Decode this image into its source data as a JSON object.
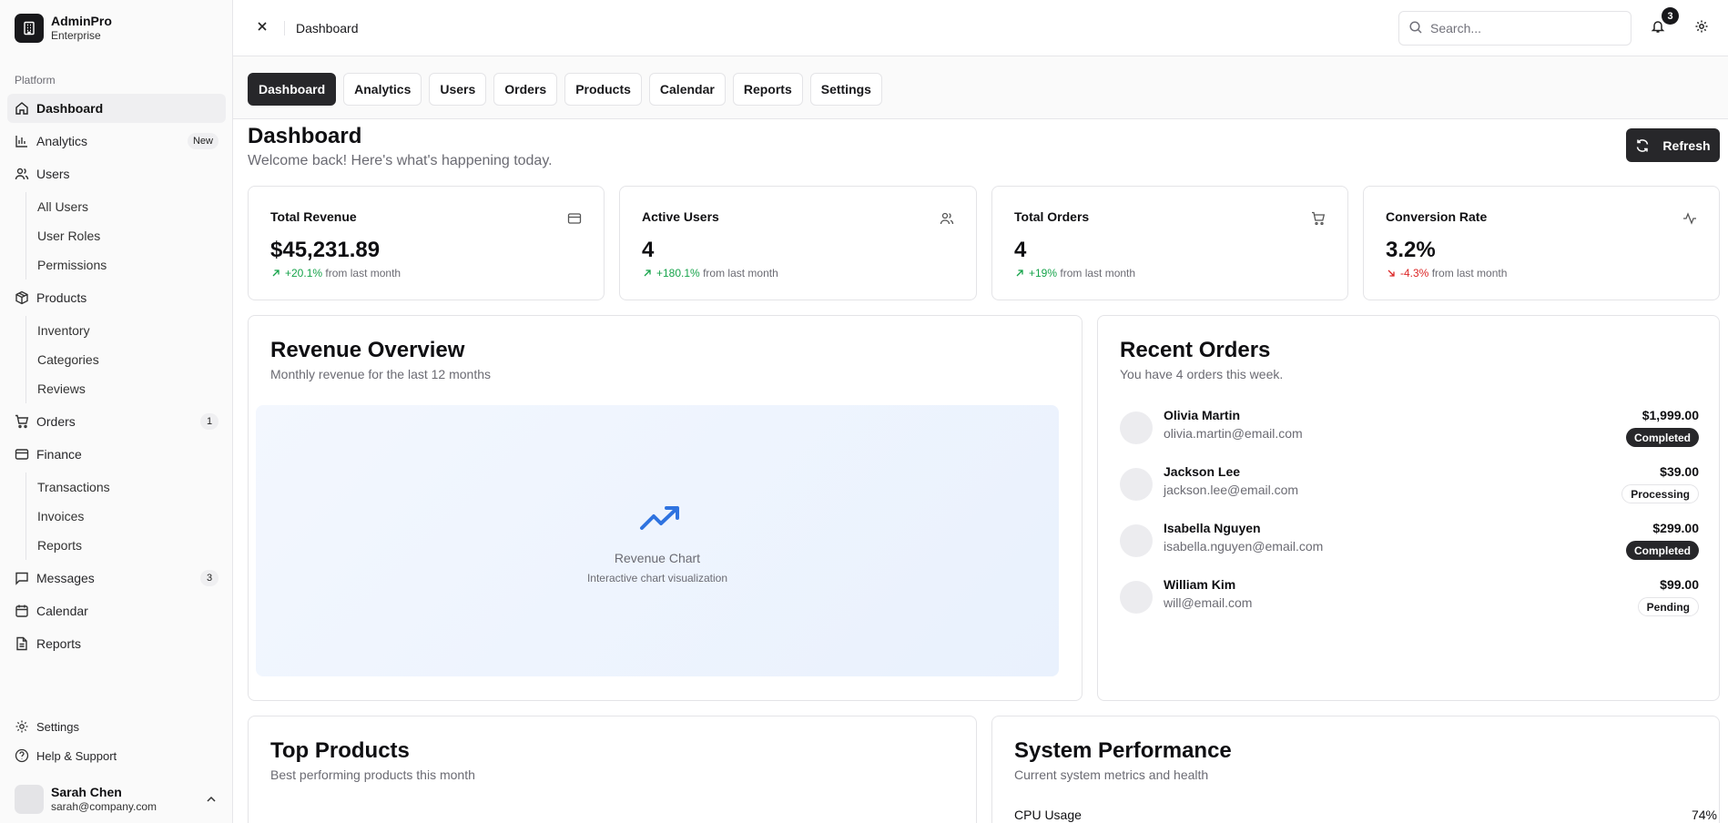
{
  "brand": {
    "name": "AdminPro",
    "subtitle": "Enterprise"
  },
  "sidebar": {
    "group_label": "Platform",
    "items": [
      {
        "label": "Dashboard",
        "icon": "home-icon",
        "active": true
      },
      {
        "label": "Analytics",
        "icon": "bar-chart-icon",
        "badge": "New"
      },
      {
        "label": "Users",
        "icon": "users-icon",
        "children": [
          "All Users",
          "User Roles",
          "Permissions"
        ]
      },
      {
        "label": "Products",
        "icon": "package-icon",
        "children": [
          "Inventory",
          "Categories",
          "Reviews"
        ]
      },
      {
        "label": "Orders",
        "icon": "cart-icon",
        "badge": "1"
      },
      {
        "label": "Finance",
        "icon": "credit-card-icon",
        "children": [
          "Transactions",
          "Invoices",
          "Reports"
        ]
      },
      {
        "label": "Messages",
        "icon": "message-icon",
        "badge": "3"
      },
      {
        "label": "Calendar",
        "icon": "calendar-icon"
      },
      {
        "label": "Reports",
        "icon": "file-icon"
      }
    ],
    "footer": {
      "settings_label": "Settings",
      "help_label": "Help & Support",
      "user_name": "Sarah Chen",
      "user_email": "sarah@company.com"
    }
  },
  "topbar": {
    "title": "Dashboard",
    "search_placeholder": "Search...",
    "notification_count": "3"
  },
  "tabs": [
    "Dashboard",
    "Analytics",
    "Users",
    "Orders",
    "Products",
    "Calendar",
    "Reports",
    "Settings"
  ],
  "page": {
    "title": "Dashboard",
    "subtitle": "Welcome back! Here's what's happening today.",
    "refresh_label": "Refresh"
  },
  "stats": [
    {
      "title": "Total Revenue",
      "value": "$45,231.89",
      "change": "+20.1%",
      "trend": "up",
      "suffix": "from last month",
      "icon": "credit-card-icon"
    },
    {
      "title": "Active Users",
      "value": "4",
      "change": "+180.1%",
      "trend": "up",
      "suffix": "from last month",
      "icon": "users-icon"
    },
    {
      "title": "Total Orders",
      "value": "4",
      "change": "+19%",
      "trend": "up",
      "suffix": "from last month",
      "icon": "cart-icon"
    },
    {
      "title": "Conversion Rate",
      "value": "3.2%",
      "change": "-4.3%",
      "trend": "down",
      "suffix": "from last month",
      "icon": "activity-icon"
    }
  ],
  "revenue": {
    "title": "Revenue Overview",
    "subtitle": "Monthly revenue for the last 12 months",
    "placeholder_label": "Revenue Chart",
    "placeholder_desc": "Interactive chart visualization"
  },
  "recent_orders": {
    "title": "Recent Orders",
    "subtitle": "You have 4 orders this week.",
    "orders": [
      {
        "name": "Olivia Martin",
        "email": "olivia.martin@email.com",
        "amount": "$1,999.00",
        "status": "Completed"
      },
      {
        "name": "Jackson Lee",
        "email": "jackson.lee@email.com",
        "amount": "$39.00",
        "status": "Processing"
      },
      {
        "name": "Isabella Nguyen",
        "email": "isabella.nguyen@email.com",
        "amount": "$299.00",
        "status": "Completed"
      },
      {
        "name": "William Kim",
        "email": "will@email.com",
        "amount": "$99.00",
        "status": "Pending"
      }
    ]
  },
  "top_products": {
    "title": "Top Products",
    "subtitle": "Best performing products this month"
  },
  "system": {
    "title": "System Performance",
    "subtitle": "Current system metrics and health",
    "metrics": [
      {
        "label": "CPU Usage",
        "value": "74%"
      }
    ]
  },
  "colors": {
    "accent": "#27272a",
    "positive": "#16a34a",
    "negative": "#dc2626",
    "chart_icon": "#2f73e0"
  }
}
